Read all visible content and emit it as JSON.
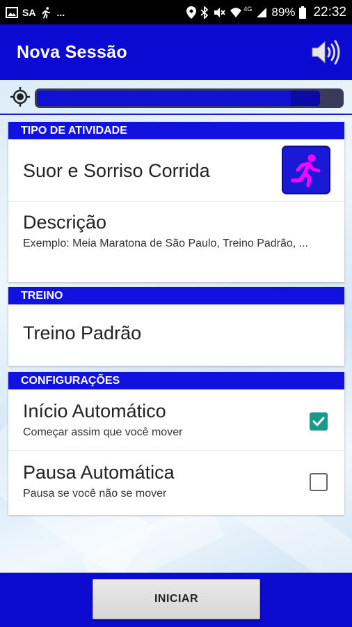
{
  "status_bar": {
    "carrier": "SA",
    "extra": "...",
    "network": "4G",
    "battery": "89%",
    "time": "22:32"
  },
  "app_bar": {
    "title": "Nova Sessão",
    "speaker_icon": "speaker-volume-icon"
  },
  "gps": {
    "icon": "gps-location-icon",
    "signal_fraction": 0.93
  },
  "activity_section": {
    "header": "TIPO DE ATIVIDADE",
    "activity_name": "Suor e Sorriso Corrida",
    "activity_icon": "running-person-icon",
    "description_title": "Descrição",
    "description_hint": "Exemplo: Meia Maratona de São Paulo, Treino Padrão, ..."
  },
  "training_section": {
    "header": "TREINO",
    "training_name": "Treino Padrão"
  },
  "settings_section": {
    "header": "CONFIGURAÇÕES",
    "auto_start": {
      "title": "Início Automático",
      "subtitle": "Começar assim que você mover",
      "checked": true
    },
    "auto_pause": {
      "title": "Pausa Automática",
      "subtitle": "Pausa se você não se mover",
      "checked": false
    }
  },
  "footer": {
    "start_label": "INICIAR"
  },
  "colors": {
    "primary_blue": "#0a0ad2",
    "section_header_blue": "#1111e0",
    "checkbox_teal": "#179a8a",
    "activity_icon_magenta": "#ff00ff"
  }
}
